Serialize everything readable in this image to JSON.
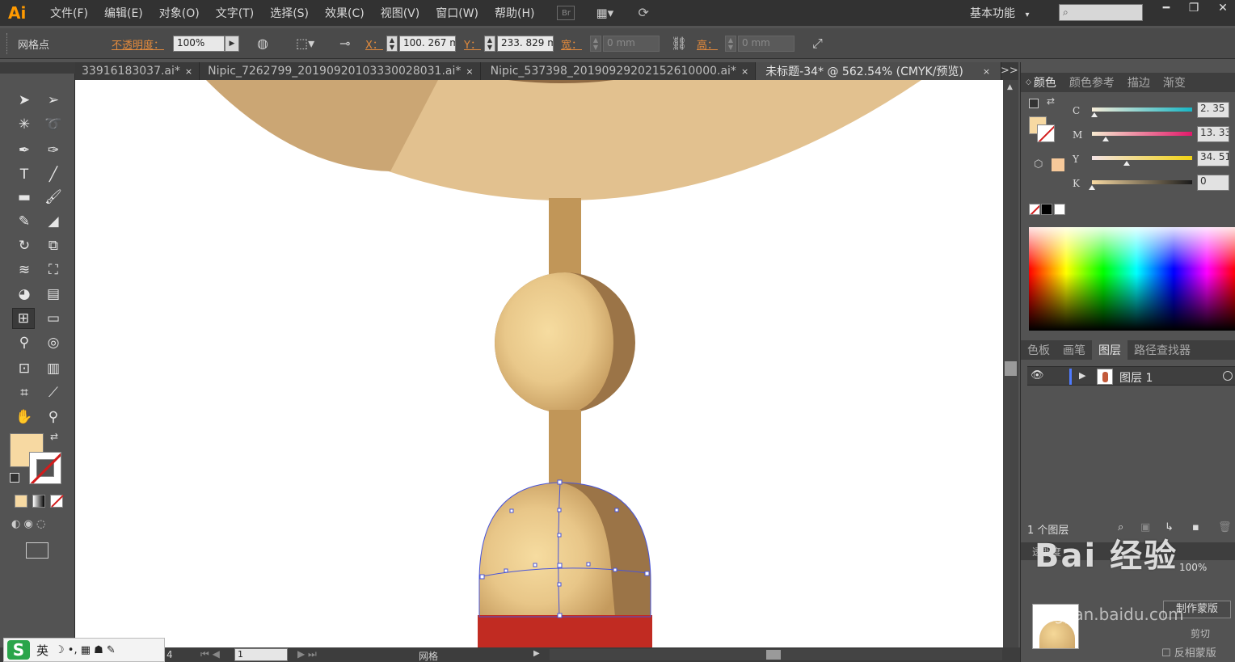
{
  "app": {
    "logo": "Ai"
  },
  "menu": [
    "文件(F)",
    "编辑(E)",
    "对象(O)",
    "文字(T)",
    "选择(S)",
    "效果(C)",
    "视图(V)",
    "窗口(W)",
    "帮助(H)"
  ],
  "menu_icons": {
    "bridge": "Br",
    "arrange": "arrange-documents-icon",
    "gpu": "gpu-performance-icon"
  },
  "workspace": {
    "label": "基本功能",
    "arrow": "▾"
  },
  "search": {
    "placeholder": ""
  },
  "window_controls": {
    "minimize": "━",
    "restore": "❐",
    "close": "✕"
  },
  "control_bar": {
    "selection_type": "网格点",
    "opacity_label": "不透明度：",
    "opacity_value": "100%",
    "x_label": "X：",
    "x_value": "100. 267 m",
    "y_label": "Y：",
    "y_value": "233. 829 m",
    "w_label": "宽：",
    "w_value": "0 mm",
    "h_label": "高：",
    "h_value": "0 mm"
  },
  "tabs": [
    {
      "label": "33916183037.ai*",
      "active": false
    },
    {
      "label": "Nipic_7262799_20190920103330028031.ai*",
      "active": false
    },
    {
      "label": "Nipic_537398_20190929202152610000.ai*",
      "active": false
    },
    {
      "label": "未标题-34* @ 562.54% (CMYK/预览)",
      "active": true
    }
  ],
  "tab_close": "×",
  "tab_overflow": ">>",
  "tools": [
    "selection-tool-icon",
    "direct-selection-tool-icon",
    "magic-wand-tool-icon",
    "lasso-tool-icon",
    "pen-tool-icon",
    "curvature-tool-icon",
    "type-tool-icon",
    "line-segment-tool-icon",
    "rectangle-tool-icon",
    "paintbrush-tool-icon",
    "pencil-tool-icon",
    "eraser-tool-icon",
    "rotate-tool-icon",
    "scale-tool-icon",
    "warp-tool-icon",
    "free-transform-tool-icon",
    "shape-builder-tool-icon",
    "perspective-grid-tool-icon",
    "mesh-tool-icon",
    "gradient-tool-icon",
    "eyedropper-tool-icon",
    "blend-tool-icon",
    "symbol-sprayer-tool-icon",
    "column-graph-tool-icon",
    "artboard-tool-icon",
    "slice-tool-icon",
    "hand-tool-icon",
    "zoom-tool-icon"
  ],
  "colors": {
    "fill": "#f7d9a2",
    "stroke": "none",
    "accent_orange": "#e28a3c",
    "mesh_path": "#4a55d8",
    "lamp_shade": "#e2c18f",
    "pole": "#c19658",
    "ball_shadow": "#9b7447",
    "base_red": "#c12b22"
  },
  "color_panel": {
    "tabs": [
      "颜色",
      "颜色参考",
      "描边",
      "渐变"
    ],
    "active_tab": "颜色",
    "channels": [
      {
        "name": "C",
        "value": "2. 35",
        "percent": 2.35
      },
      {
        "name": "M",
        "value": "13. 33",
        "percent": 13.33
      },
      {
        "name": "Y",
        "value": "34. 51",
        "percent": 34.51
      },
      {
        "name": "K",
        "value": "0",
        "percent": 0
      }
    ]
  },
  "layers_panel": {
    "tabs": [
      "色板",
      "画笔",
      "图层",
      "路径查找器"
    ],
    "active_tab": "图层",
    "layers": [
      {
        "name": "图层 1"
      }
    ],
    "footer": "1 个图层"
  },
  "transparency_panel": {
    "tab": "透明度",
    "opacity": "100%",
    "make_mask": "制作蒙版",
    "clip": "剪切",
    "invert_mask": "反相蒙版"
  },
  "status_bar": {
    "zoom_field": "1",
    "page_prefix": "4",
    "tool_label": "网格"
  },
  "ime": {
    "logo": "S",
    "lang": "英",
    "symbols": "☽ •, ▦ ☗ ✎"
  },
  "watermark": {
    "text": "Bai 经验",
    "sub": "jingyan.baidu.com"
  }
}
